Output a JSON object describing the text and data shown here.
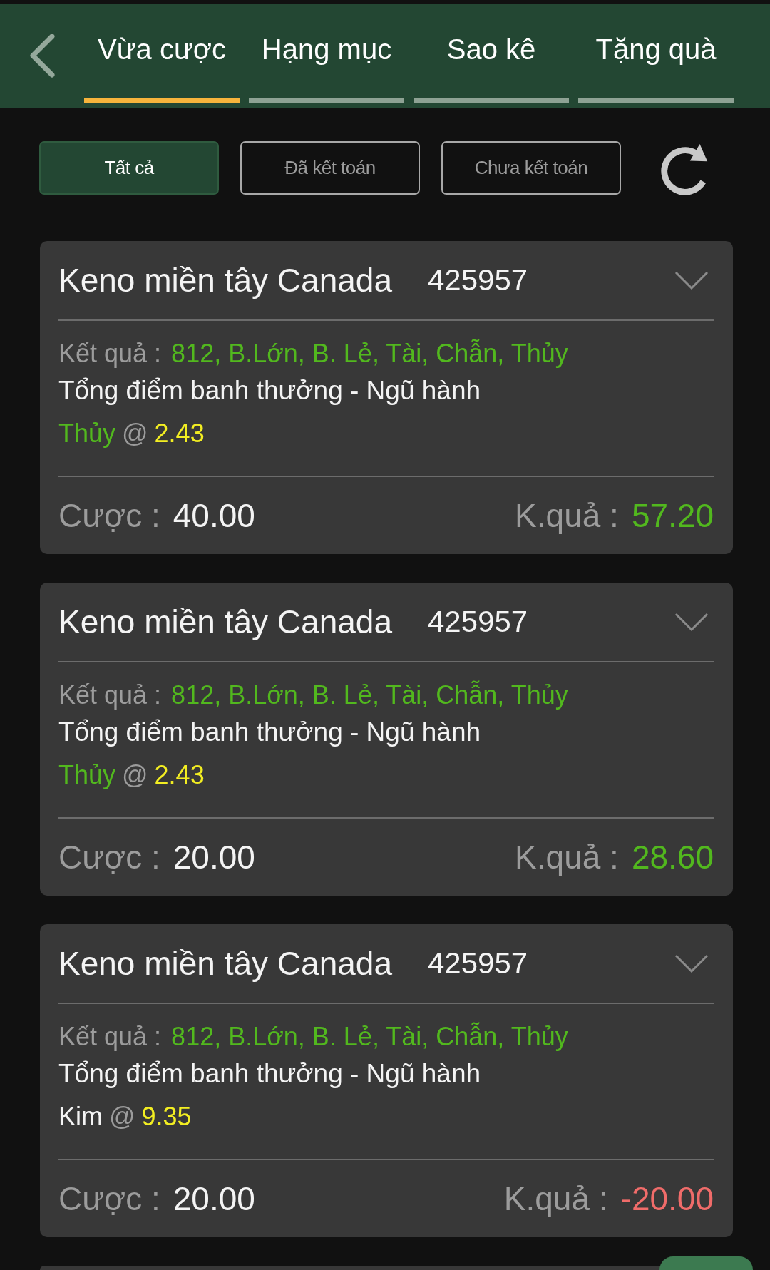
{
  "tabs": [
    {
      "label": "Vừa cược",
      "selected": true
    },
    {
      "label": "Hạng mục",
      "selected": false
    },
    {
      "label": "Sao kê",
      "selected": false
    },
    {
      "label": "Tặng quà",
      "selected": false
    }
  ],
  "filters": [
    {
      "label": "Tất cả",
      "selected": true
    },
    {
      "label": "Đã kết toán",
      "selected": false
    },
    {
      "label": "Chưa kết toán",
      "selected": false
    }
  ],
  "bets": [
    {
      "game": "Keno miền tây Canada",
      "draw": "425957",
      "result_label": "Kết quả :",
      "result": "812, B.Lớn, B. Lẻ, Tài, Chẫn, Thủy",
      "market": "Tổng điểm banh thưởng - Ngũ hành",
      "pick": "Thủy",
      "pick_hit": true,
      "at": "@",
      "odds": "2.43",
      "stake_label": "Cược :",
      "stake": "40.00",
      "payout_label": "K.quả :",
      "payout": "57.20",
      "won": true
    },
    {
      "game": "Keno miền tây Canada",
      "draw": "425957",
      "result_label": "Kết quả :",
      "result": "812, B.Lớn, B. Lẻ, Tài, Chẫn, Thủy",
      "market": "Tổng điểm banh thưởng - Ngũ hành",
      "pick": "Thủy",
      "pick_hit": true,
      "at": "@",
      "odds": "2.43",
      "stake_label": "Cược :",
      "stake": "20.00",
      "payout_label": "K.quả :",
      "payout": "28.60",
      "won": true
    },
    {
      "game": "Keno miền tây Canada",
      "draw": "425957",
      "result_label": "Kết quả :",
      "result": "812, B.Lớn, B. Lẻ, Tài, Chẫn, Thủy",
      "market": "Tổng điểm banh thưởng - Ngũ hành",
      "pick": "Kim",
      "pick_hit": false,
      "at": "@",
      "odds": "9.35",
      "stake_label": "Cược :",
      "stake": "20.00",
      "payout_label": "K.quả :",
      "payout": "-20.00",
      "won": false
    }
  ]
}
